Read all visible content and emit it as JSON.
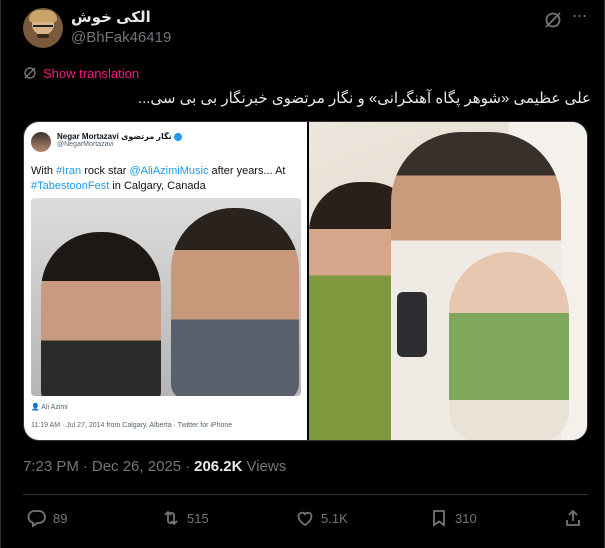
{
  "author": {
    "display_name": "الکی خوش",
    "handle": "@BhFak46419",
    "avatar_icon": "avatar-icon"
  },
  "header_icons": {
    "grok": "grok-icon",
    "more": "more-icon"
  },
  "translation": {
    "label": "Show translation",
    "color": "#f91880"
  },
  "tweet": {
    "text": "علی عظیمی «شوهر پگاه آهنگرانی» و نگار مرتضوی خبرنگار بی بی سی..."
  },
  "quoted": {
    "name": "Negar Mortazavi نگار مرتضوی",
    "handle": "@NegarMortazavi",
    "text_prefix": "With ",
    "tag_iran": "#Iran",
    "text_mid": " rock star ",
    "mention": "@AliAzimiMusic",
    "text_after": " after years... At ",
    "tag_fest": "#TabestoonFest",
    "text_end": " in Calgary, Canada",
    "tagged_user": "Ali Azimi",
    "meta": "11:19 AM · Jul 27, 2014 from Calgary, Alberta · Twitter for iPhone"
  },
  "post_meta": {
    "time": "7:23 PM",
    "separator": "·",
    "date": "Dec 26, 2025",
    "separator2": "·",
    "views_count": "206.2K",
    "views_label": "Views"
  },
  "actions": {
    "replies": "89",
    "reposts": "515",
    "likes": "5.1K",
    "bookmarks": "310"
  },
  "colors": {
    "background": "#000000",
    "text": "#e7e9ea",
    "muted": "#71767b",
    "accent": "#1d9bf0",
    "border": "#2f3336"
  }
}
